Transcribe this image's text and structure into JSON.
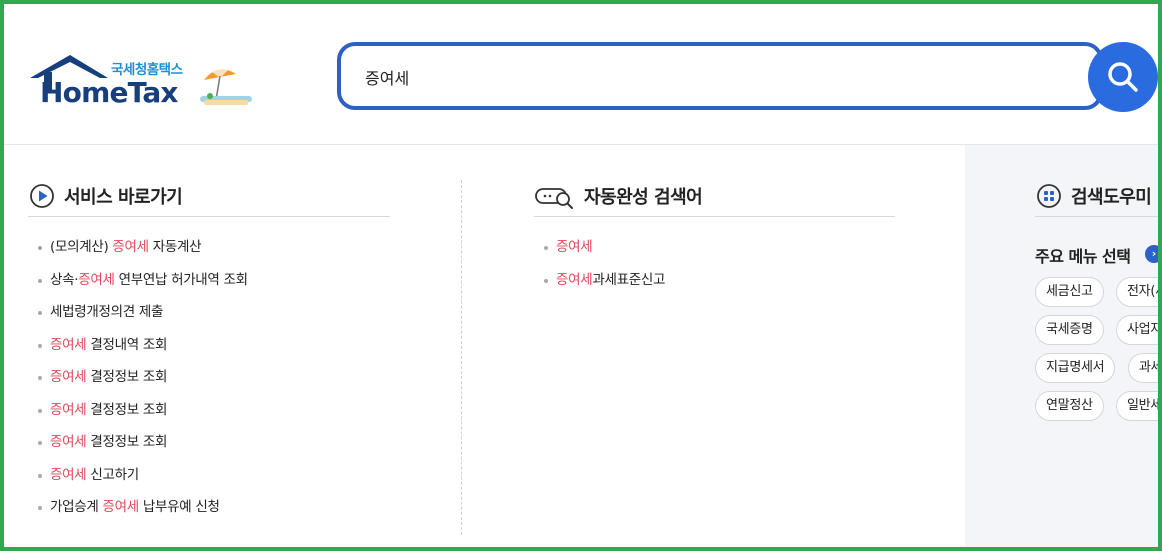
{
  "logo": {
    "subtitle": "국세청홈택스",
    "title": "HomeTax"
  },
  "search": {
    "value": "증여세",
    "button_label": "검색"
  },
  "service_shortcuts": {
    "title": "서비스 바로가기",
    "items": [
      {
        "before": "(모의계산) ",
        "highlight": "증여세",
        "after": " 자동계산"
      },
      {
        "before": "상속·",
        "highlight": "증여세",
        "after": " 연부연납 허가내역 조회"
      },
      {
        "before": "세법령개정의견 제출",
        "highlight": "",
        "after": ""
      },
      {
        "before": "",
        "highlight": "증여세",
        "after": " 결정내역 조회"
      },
      {
        "before": "",
        "highlight": "증여세",
        "after": " 결정정보 조회"
      },
      {
        "before": "",
        "highlight": "증여세",
        "after": " 결정정보 조회"
      },
      {
        "before": "",
        "highlight": "증여세",
        "after": " 결정정보 조회"
      },
      {
        "before": "",
        "highlight": "증여세",
        "after": " 신고하기"
      },
      {
        "before": "가업승계 ",
        "highlight": "증여세",
        "after": " 납부유예 신청"
      }
    ]
  },
  "autocomplete": {
    "title": "자동완성 검색어",
    "items": [
      {
        "before": "",
        "highlight": "증여세",
        "after": ""
      },
      {
        "before": "",
        "highlight": "증여세",
        "after": "과세표준신고"
      }
    ]
  },
  "search_help": {
    "title": "검색도우미",
    "menu_title": "주요 메뉴 선택",
    "chips": [
      "세금신고",
      "전자(세금)계산서",
      "국세증명",
      "사업자등록",
      "지급명세서",
      "과세자료",
      "연말정산",
      "일반세무"
    ]
  },
  "colors": {
    "accent": "#2a62c8",
    "highlight": "#e0485a",
    "frame": "#2fa84f",
    "panel_bg": "#f3f5f9"
  },
  "icons": {
    "search": "search-icon",
    "service": "play-circle-icon",
    "autocomplete": "chat-search-icon",
    "help": "grid-circle-icon"
  }
}
